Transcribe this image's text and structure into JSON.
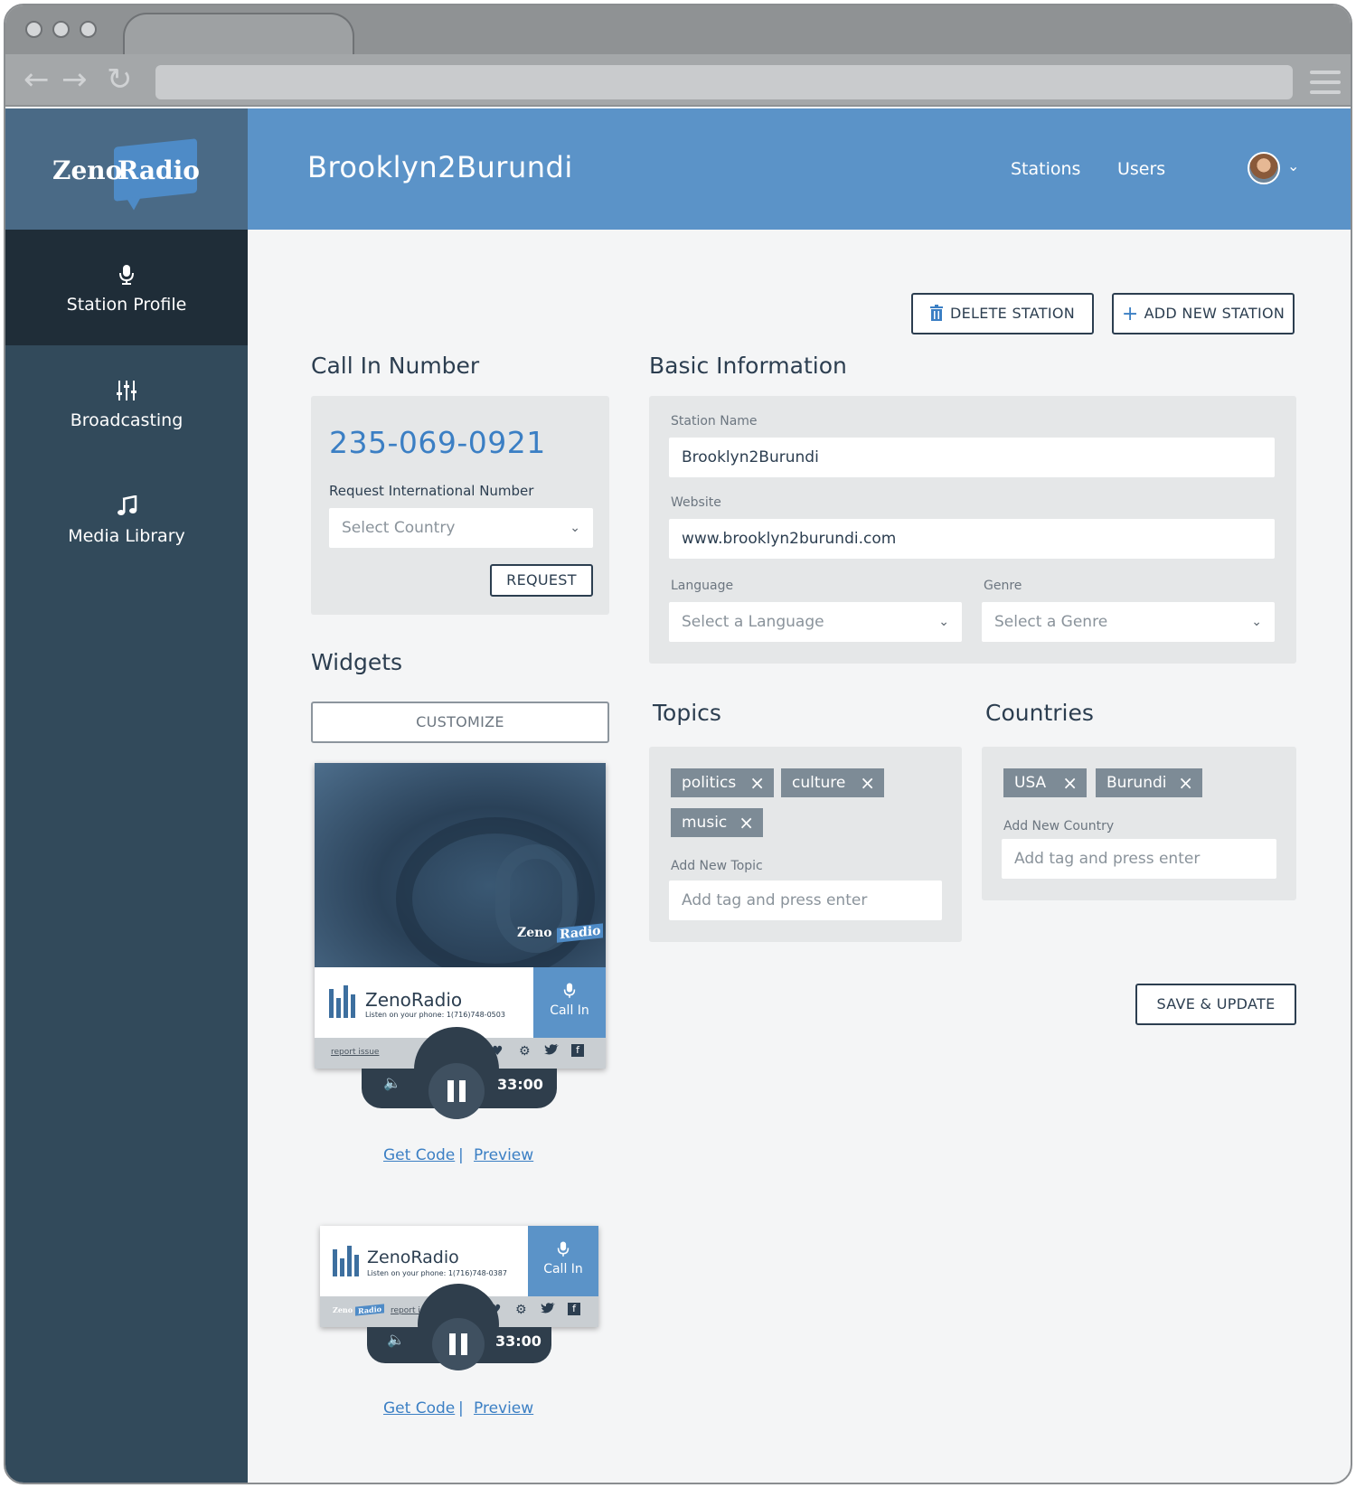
{
  "app": {
    "brand": "Zeno Radio",
    "brand_part1": "Zeno",
    "brand_part2": "Radio",
    "station_title": "Brooklyn2Burundi",
    "nav": {
      "stations": "Stations",
      "users": "Users"
    }
  },
  "sidebar": {
    "items": [
      {
        "label": "Station Profile",
        "icon": "microphone-icon",
        "active": true
      },
      {
        "label": "Broadcasting",
        "icon": "sliders-icon"
      },
      {
        "label": "Media Library",
        "icon": "music-note-icon"
      }
    ]
  },
  "actions": {
    "delete": "DELETE STATION",
    "add": "ADD NEW STATION",
    "save": "SAVE & UPDATE"
  },
  "call_in": {
    "title": "Call In Number",
    "number": "235-069-0921",
    "request_label": "Request International Number",
    "country_placeholder": "Select Country",
    "request_button": "REQUEST"
  },
  "basic_info": {
    "title": "Basic Information",
    "station_name_label": "Station Name",
    "station_name": "Brooklyn2Burundi",
    "website_label": "Website",
    "website": "www.brooklyn2burundi.com",
    "language_label": "Language",
    "language_placeholder": "Select a Language",
    "genre_label": "Genre",
    "genre_placeholder": "Select a Genre"
  },
  "topics": {
    "title": "Topics",
    "tags": [
      "politics",
      "culture",
      "music"
    ],
    "add_label": "Add New Topic",
    "placeholder": "Add tag and press enter"
  },
  "countries": {
    "title": "Countries",
    "tags": [
      "USA",
      "Burundi"
    ],
    "add_label": "Add New Country",
    "placeholder": "Add tag and press enter"
  },
  "widgets": {
    "title": "Widgets",
    "customize": "CUSTOMIZE",
    "items": [
      {
        "name": "ZenoRadio",
        "subtitle": "Listen on your phone: 1(716)748-0503",
        "call_in": "Call In",
        "report": "report issue",
        "time": "33:00"
      },
      {
        "name": "ZenoRadio",
        "subtitle": "Listen on your phone: 1(716)748-0387",
        "call_in": "Call In",
        "report": "report issue",
        "time": "33:00"
      }
    ],
    "get_code": "Get Code",
    "separator": "|",
    "preview": "Preview"
  },
  "colors": {
    "header": "#5b93c8",
    "sidebar": "#324a5b",
    "sidebar_active": "#1f2d38",
    "tag": "#7d8b96",
    "link": "#3b7fc4"
  }
}
